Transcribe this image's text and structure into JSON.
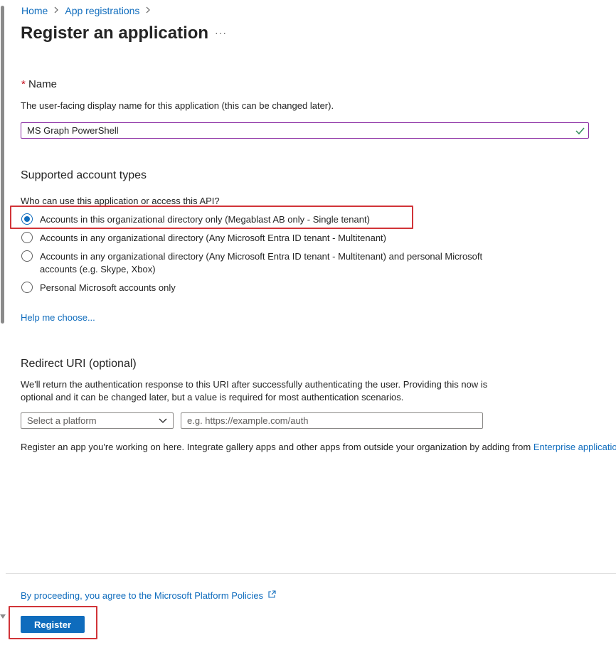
{
  "breadcrumb": {
    "items": [
      {
        "label": "Home"
      },
      {
        "label": "App registrations"
      }
    ]
  },
  "page": {
    "title": "Register an application",
    "more_label": "···"
  },
  "name_section": {
    "required_marker": "*",
    "label": "Name",
    "description": "The user-facing display name for this application (this can be changed later).",
    "value": "MS Graph PowerShell",
    "valid_icon": "checkmark-icon"
  },
  "account_types": {
    "title": "Supported account types",
    "question": "Who can use this application or access this API?",
    "options": [
      {
        "label": "Accounts in this organizational directory only (Megablast AB only - Single tenant)",
        "selected": true
      },
      {
        "label": "Accounts in any organizational directory (Any Microsoft Entra ID tenant - Multitenant)",
        "selected": false
      },
      {
        "label": "Accounts in any organizational directory (Any Microsoft Entra ID tenant - Multitenant) and personal Microsoft accounts (e.g. Skype, Xbox)",
        "selected": false
      },
      {
        "label": "Personal Microsoft accounts only",
        "selected": false
      }
    ],
    "help_link": "Help me choose..."
  },
  "redirect": {
    "title": "Redirect URI (optional)",
    "description": "We'll return the authentication response to this URI after successfully authenticating the user. Providing this now is optional and it can be changed later, but a value is required for most authentication scenarios.",
    "platform_placeholder": "Select a platform",
    "uri_placeholder": "e.g. https://example.com/auth"
  },
  "gallery_note": {
    "text": "Register an app you're working on here. Integrate gallery apps and other apps from outside your organization by adding from",
    "link": "Enterprise applications"
  },
  "footer": {
    "policy_link": "By proceeding, you agree to the Microsoft Platform Policies",
    "register_label": "Register"
  },
  "colors": {
    "accent": "#0f6cbd",
    "highlight": "#d13438",
    "valid": "#2e8b57",
    "input_focus_border": "#8a2ba2"
  }
}
